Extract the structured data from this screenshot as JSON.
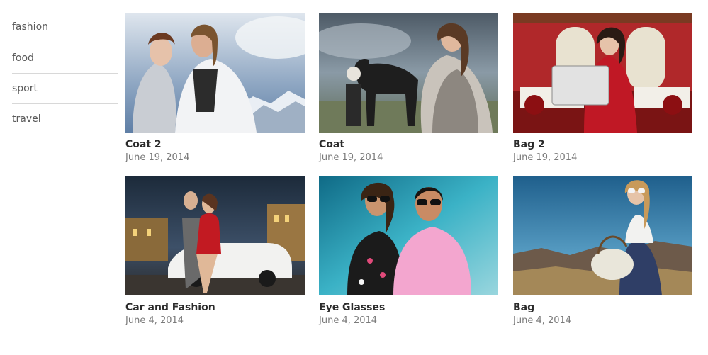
{
  "sidebar": {
    "categories": [
      {
        "label": "fashion"
      },
      {
        "label": "food"
      },
      {
        "label": "sport"
      },
      {
        "label": "travel"
      }
    ]
  },
  "posts": [
    {
      "title": "Coat 2",
      "date": "June 19, 2014"
    },
    {
      "title": "Coat",
      "date": "June 19, 2014"
    },
    {
      "title": "Bag 2",
      "date": "June 19, 2014"
    },
    {
      "title": "Car and Fashion",
      "date": "June 4, 2014"
    },
    {
      "title": "Eye Glasses",
      "date": "June 4, 2014"
    },
    {
      "title": "Bag",
      "date": "June 4, 2014"
    }
  ]
}
